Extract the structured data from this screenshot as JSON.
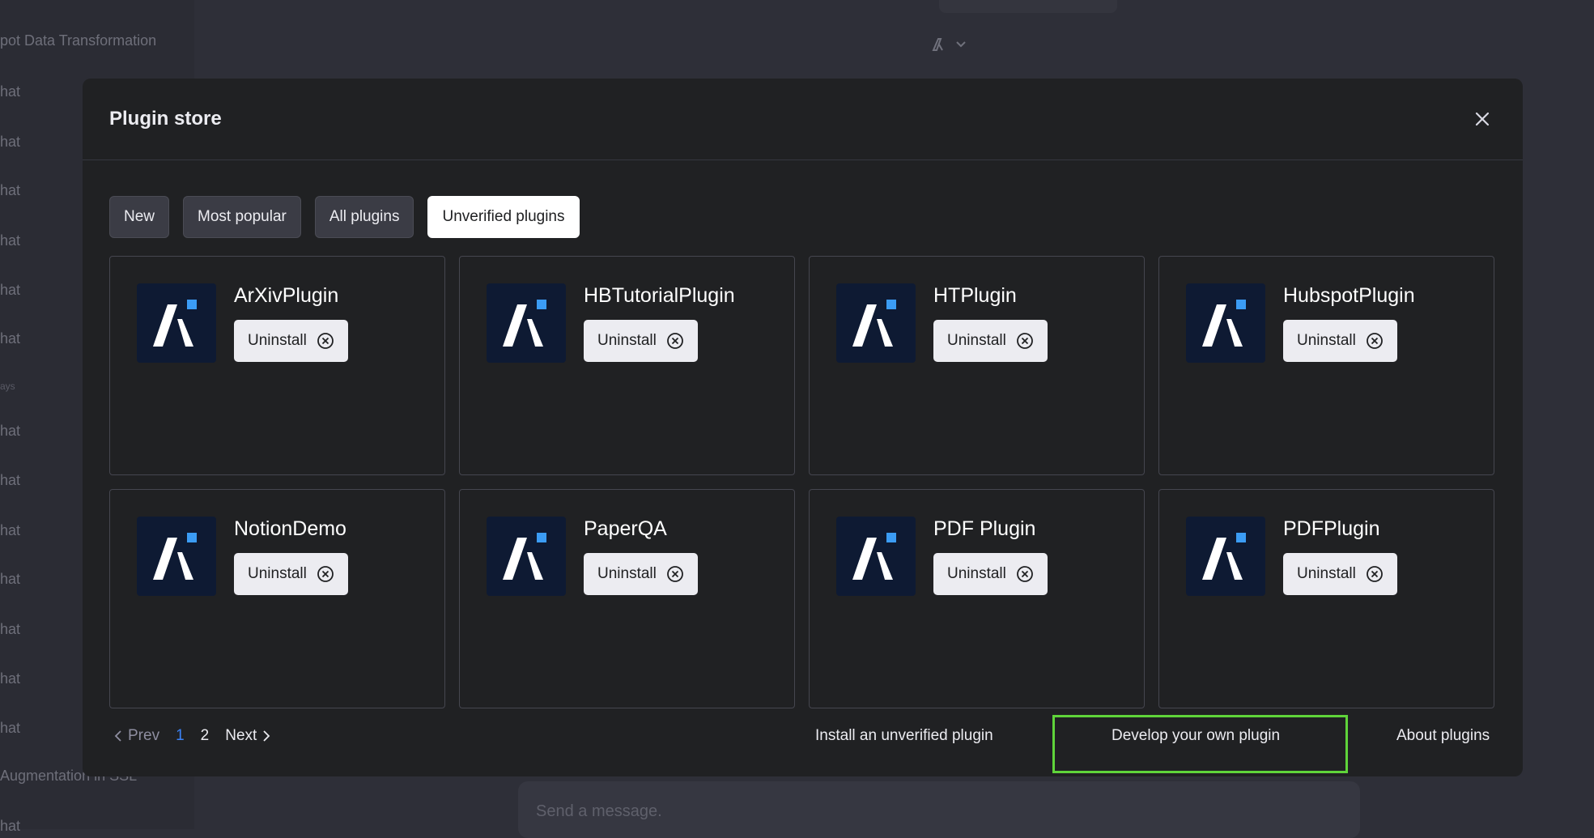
{
  "background": {
    "sidebar_items": [
      {
        "text": "pot Data Transformation",
        "small": false
      },
      {
        "text": "hat",
        "small": false
      },
      {
        "text": "hat",
        "small": false
      },
      {
        "text": "hat",
        "small": false
      },
      {
        "text": "hat",
        "small": false
      },
      {
        "text": "hat",
        "small": false
      },
      {
        "text": "hat",
        "small": false
      },
      {
        "text": "ays",
        "small": true
      },
      {
        "text": "hat",
        "small": false
      },
      {
        "text": "hat",
        "small": false
      },
      {
        "text": "hat",
        "small": false
      },
      {
        "text": "hat",
        "small": false
      },
      {
        "text": "hat",
        "small": false
      },
      {
        "text": "hat",
        "small": false
      },
      {
        "text": "hat",
        "small": false
      },
      {
        "text": "Augmentation in SSL",
        "small": false
      },
      {
        "text": "hat",
        "small": false
      }
    ],
    "input_placeholder": "Send a message."
  },
  "modal": {
    "title": "Plugin store",
    "tabs": [
      {
        "label": "New",
        "active": false
      },
      {
        "label": "Most popular",
        "active": false
      },
      {
        "label": "All plugins",
        "active": false
      },
      {
        "label": "Unverified plugins",
        "active": true
      }
    ],
    "plugins": [
      {
        "name": "ArXivPlugin",
        "button": "Uninstall"
      },
      {
        "name": "HBTutorialPlugin",
        "button": "Uninstall"
      },
      {
        "name": "HTPlugin",
        "button": "Uninstall"
      },
      {
        "name": "HubspotPlugin",
        "button": "Uninstall"
      },
      {
        "name": "NotionDemo",
        "button": "Uninstall"
      },
      {
        "name": "PaperQA",
        "button": "Uninstall"
      },
      {
        "name": "PDF Plugin",
        "button": "Uninstall"
      },
      {
        "name": "PDFPlugin",
        "button": "Uninstall"
      }
    ],
    "pagination": {
      "prev": "Prev",
      "pages": [
        "1",
        "2"
      ],
      "current": "1",
      "next": "Next"
    },
    "footer_links": {
      "install_unverified": "Install an unverified plugin",
      "develop_own": "Develop your own plugin",
      "about": "About plugins"
    }
  },
  "colors": {
    "logo_bg": "#0e1a33",
    "logo_accent": "#3b9cf5",
    "highlight": "#5fd43a",
    "current_page": "#3b82f6"
  },
  "icons": {
    "close": "close-icon",
    "uninstall": "circle-x-icon",
    "prev": "chevron-left-icon",
    "next": "chevron-right-icon",
    "model": "chevron-down-icon"
  }
}
